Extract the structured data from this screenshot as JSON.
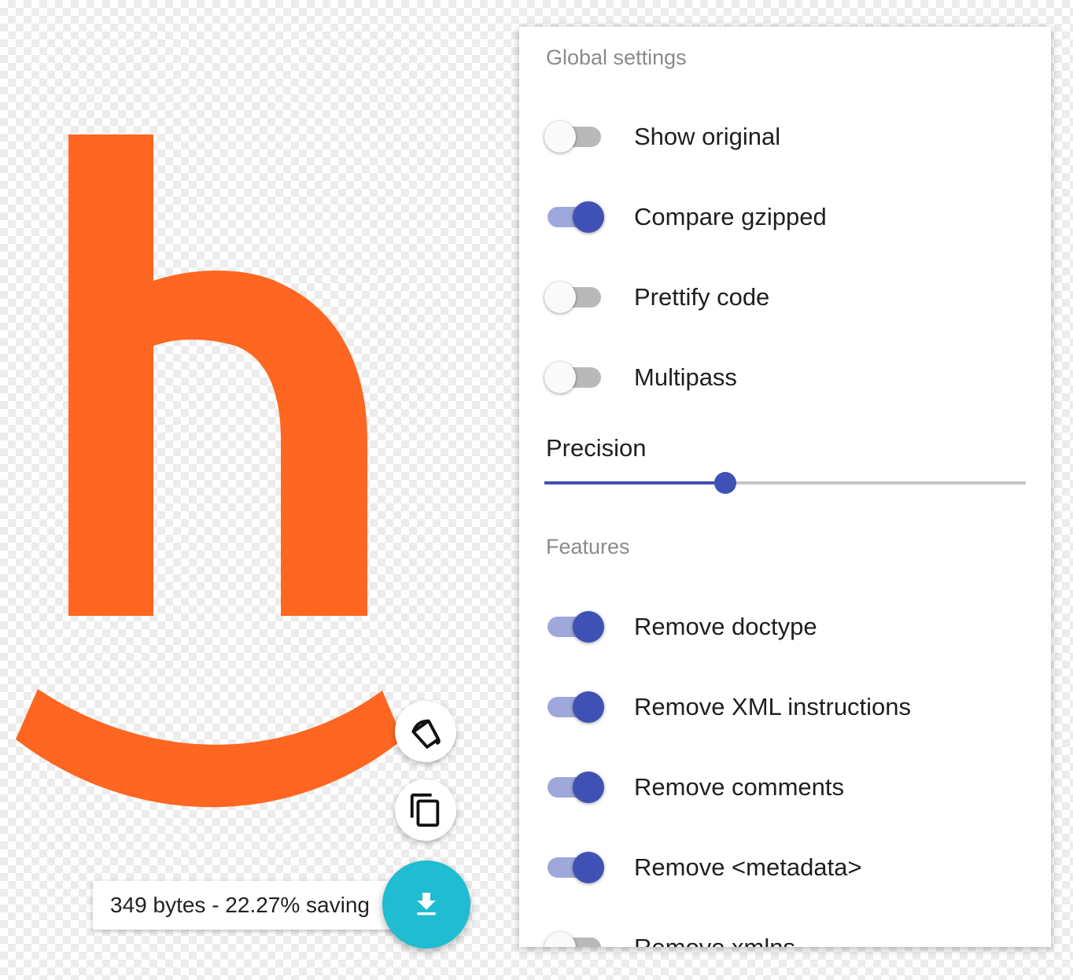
{
  "colors": {
    "logo": "#ff6622",
    "accent": "#3f51b5",
    "fab": "#1fbcd2"
  },
  "actions": {
    "background_icon": "paint-bucket-icon",
    "copy_icon": "copy-icon",
    "download_icon": "download-icon"
  },
  "results": {
    "text": "349 bytes - 22.27% saving"
  },
  "settings": {
    "global_title": "Global settings",
    "global": [
      {
        "label": "Show original",
        "checked": false
      },
      {
        "label": "Compare gzipped",
        "checked": true
      },
      {
        "label": "Prettify code",
        "checked": false
      },
      {
        "label": "Multipass",
        "checked": false
      }
    ],
    "precision_label": "Precision",
    "precision_value_fraction": 0.375,
    "features_title": "Features",
    "features": [
      {
        "label": "Remove doctype",
        "checked": true
      },
      {
        "label": "Remove XML instructions",
        "checked": true
      },
      {
        "label": "Remove comments",
        "checked": true
      },
      {
        "label": "Remove <metadata>",
        "checked": true
      },
      {
        "label": "Remove xmlns",
        "checked": false
      }
    ]
  }
}
